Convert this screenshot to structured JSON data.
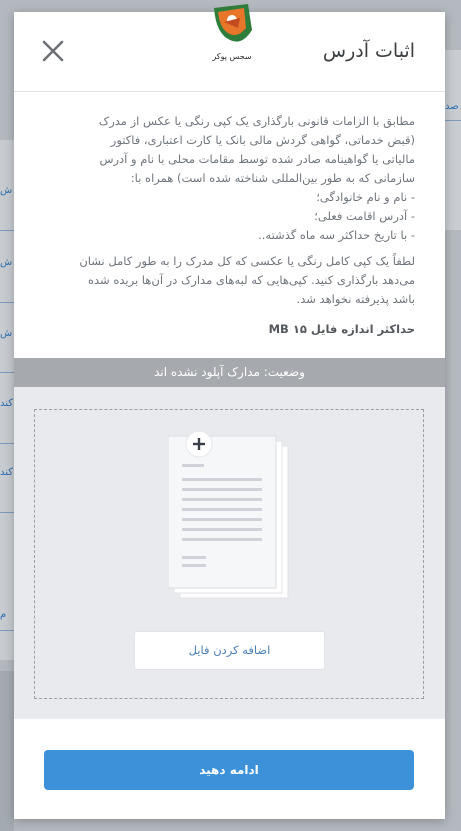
{
  "background": {
    "left_tabs": [
      "ش",
      "ش",
      "ش",
      "کند",
      "کند",
      "م"
    ],
    "right_tab": "صد"
  },
  "modal": {
    "logo_text": "سجس پوکر",
    "title": "اثبات آدرس",
    "close_icon": "close-icon"
  },
  "body": {
    "description": "مطابق با الزامات قانونی بارگذاری یک کپی رنگی یا عکس از مدرک\n(قبض خدماتی، گواهی گردش مالی بانک یا کارت اعتباری، فاکتور\nمالیاتی یا گواهینامه صادر شده توسط مقامات محلی با نام و آدرس\nسازمانی که به طور بین‌المللی شناخته شده است) همراه با:\n- نام و نام خانوادگی؛\n- آدرس اقامت فعلی؛\n- با تاریخ حداکثر سه ماه گذشته..",
    "instruction": "لطفاً یک کپی کامل رنگی یا عکسی که کل مدرک را به طور کامل نشان\nمی‌دهد بارگذاری کنید. کپی‌هایی که لبه‌های مدارک در آن‌ها بریده شده\nباشد پذیرفته نخواهد شد.",
    "max_file_size": "حداکثر اندازه فایل ۱۵ MB"
  },
  "status": {
    "text": "وضعیت: مدارک آپلود نشده اند"
  },
  "upload": {
    "add_file_label": "اضافه کردن فایل"
  },
  "footer": {
    "continue_label": "ادامه دهید"
  },
  "colors": {
    "primary": "#3c91d8",
    "status_bar": "#a6a9ad",
    "upload_bg": "#e8eaed"
  }
}
